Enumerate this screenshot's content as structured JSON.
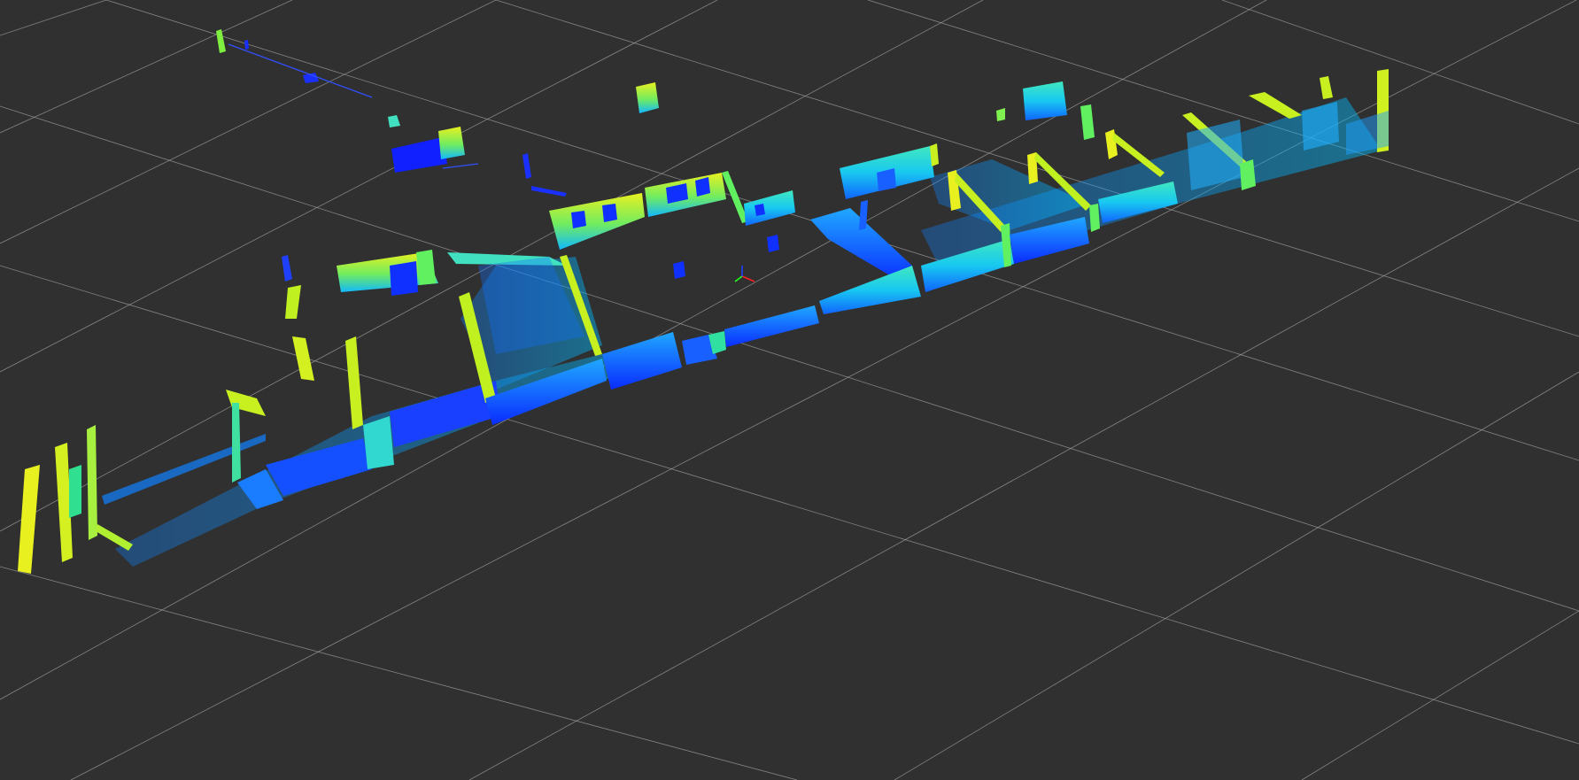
{
  "viewer": {
    "background": "#303030",
    "grid_color": "#a0a0a0",
    "axis_colors": {
      "x": "#ff2020",
      "y": "#20ff20",
      "z": "#2040ff"
    },
    "colormap": [
      "#0010ff",
      "#0a4cff",
      "#00a8ff",
      "#00e0c8",
      "#60f070",
      "#c8f020",
      "#f0f000"
    ],
    "point_cloud": "lidar-intensity-map",
    "frame_icon": "axes-icon"
  }
}
